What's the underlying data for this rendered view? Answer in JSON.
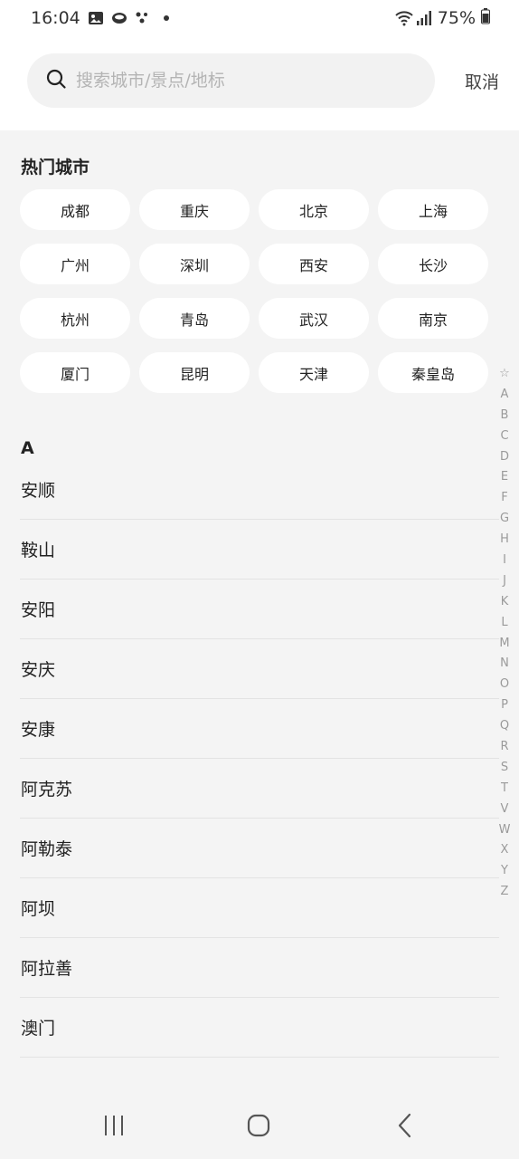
{
  "status": {
    "time": "16:04",
    "battery": "75%"
  },
  "search": {
    "placeholder": "搜索城市/景点/地标",
    "value": "",
    "cancel_label": "取消"
  },
  "hot": {
    "title": "热门城市",
    "cities": [
      "成都",
      "重庆",
      "北京",
      "上海",
      "广州",
      "深圳",
      "西安",
      "长沙",
      "杭州",
      "青岛",
      "武汉",
      "南京",
      "厦门",
      "昆明",
      "天津",
      "秦皇岛"
    ]
  },
  "sections": [
    {
      "letter": "A",
      "cities": [
        "安顺",
        "鞍山",
        "安阳",
        "安庆",
        "安康",
        "阿克苏",
        "阿勒泰",
        "阿坝",
        "阿拉善",
        "澳门"
      ]
    }
  ],
  "index": [
    "☆",
    "A",
    "B",
    "C",
    "D",
    "E",
    "F",
    "G",
    "H",
    "I",
    "J",
    "K",
    "L",
    "M",
    "N",
    "O",
    "P",
    "Q",
    "R",
    "S",
    "T",
    "V",
    "W",
    "X",
    "Y",
    "Z"
  ],
  "icons": {
    "search": "search-icon",
    "recent": "recent-apps-icon",
    "home": "home-icon",
    "back": "back-icon"
  }
}
